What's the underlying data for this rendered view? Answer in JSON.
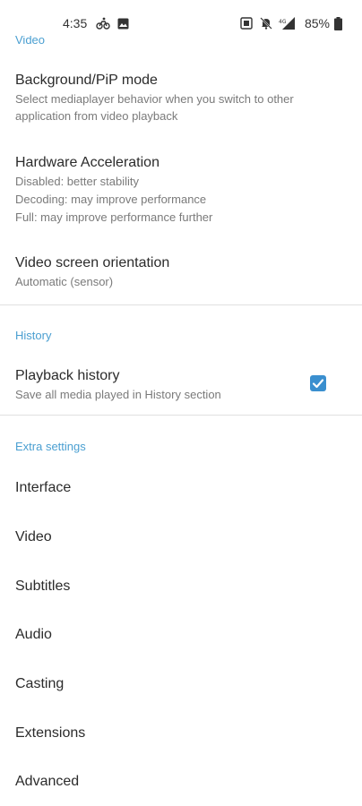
{
  "status_bar": {
    "time": "4:35",
    "battery_percent": "85%",
    "icons": [
      "cycling-icon",
      "image-icon",
      "sim-card-icon",
      "bell-off-icon",
      "signal-icon",
      "battery-icon"
    ]
  },
  "sections": {
    "video_header": "Video",
    "history_header": "History",
    "extra_header": "Extra settings"
  },
  "prefs": {
    "background_pip": {
      "title": "Background/PiP mode",
      "summary_line1": "Select mediaplayer behavior when you switch to other",
      "summary_line2": "application from video playback"
    },
    "hw_accel": {
      "title": "Hardware Acceleration",
      "line1": "Disabled: better stability",
      "line2": "Decoding: may improve performance",
      "line3": "Full: may improve performance further"
    },
    "orientation": {
      "title": "Video screen orientation",
      "summary": "Automatic (sensor)"
    },
    "playback_history": {
      "title": "Playback history",
      "summary": "Save all media played in History section",
      "checked": true
    }
  },
  "extra_items": [
    "Interface",
    "Video",
    "Subtitles",
    "Audio",
    "Casting",
    "Extensions",
    "Advanced"
  ],
  "colors": {
    "accent": "#4a9fd1",
    "checkbox": "#3a8fcf"
  }
}
